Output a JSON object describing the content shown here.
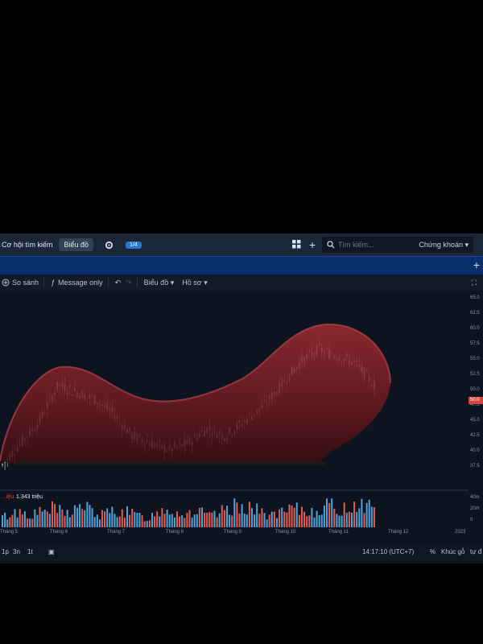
{
  "topbar": {
    "opportunity_label": "Cơ hội tìm kiếm",
    "chart_tab_label": "Biểu đồ",
    "badge_label": "1/4",
    "search_placeholder": "Tìm kiếm...",
    "search_scope": "Chứng khoán"
  },
  "chart_toolbar": {
    "compare_label": "So sánh",
    "message_label": "Message only",
    "chart_menu_label": "Biểu đồ",
    "profile_menu_label": "Hồ sơ"
  },
  "volume": {
    "label": "...iệu",
    "value": "1.343 triệu"
  },
  "price_axis": [
    "65.0",
    "62.5",
    "60.0",
    "57.5",
    "55.0",
    "52.5",
    "50.0",
    "47.5",
    "45.0",
    "42.5",
    "40.0",
    "37.5"
  ],
  "volume_axis": [
    "40m",
    "20m",
    "0"
  ],
  "current_price": "50.0",
  "months": [
    "Tháng 5",
    "Tháng 6",
    "Tháng 7",
    "Tháng 8",
    "Tháng 9",
    "Tháng 10",
    "Tháng 11",
    "Tháng 12",
    "2023"
  ],
  "bottombar": {
    "ranges": [
      "1p",
      "3n",
      "1t"
    ],
    "clock": "14:17:10 (UTC+7)",
    "percent_label": "%",
    "log_label": "Khúc gỗ",
    "auto_label": "tự đ"
  },
  "colors": {
    "up": "#26a69a",
    "down": "#ef5350",
    "volume_up": "#4fa3d9",
    "volume_down": "#e35b52",
    "overlay": "#7a1f24"
  },
  "chart_data": {
    "type": "candlestick",
    "x_categories": [
      "Tháng 5",
      "Tháng 6",
      "Tháng 7",
      "Tháng 8",
      "Tháng 9",
      "Tháng 10",
      "Tháng 11",
      "Tháng 12"
    ],
    "close_trend": [
      41,
      44,
      47,
      52,
      51,
      50,
      48,
      45,
      44,
      43,
      44,
      46,
      45,
      47,
      49,
      52,
      55,
      57,
      56,
      55,
      52
    ],
    "ylim": [
      37.5,
      65
    ],
    "volume_trend": [
      14,
      22,
      18,
      26,
      20,
      30,
      16,
      24,
      19,
      12,
      28,
      18,
      22,
      15,
      26,
      32,
      20,
      17,
      25,
      21,
      30,
      24,
      34,
      28
    ],
    "volume_ylim": [
      0,
      45
    ]
  }
}
